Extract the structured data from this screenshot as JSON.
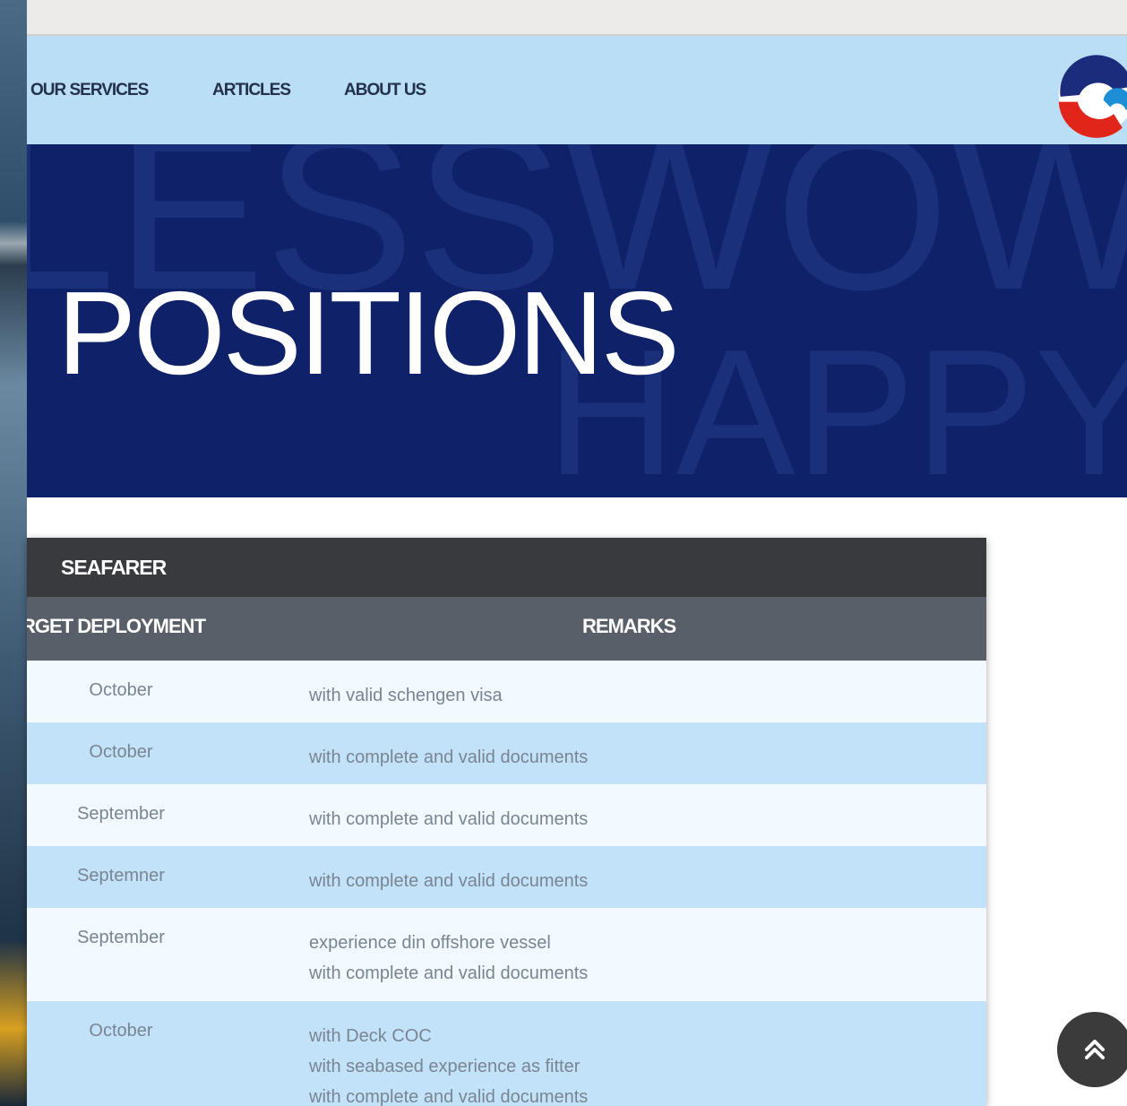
{
  "nav": {
    "links": [
      "OUR SERVICES",
      "ARTICLES",
      "ABOUT US"
    ]
  },
  "hero": {
    "title": "POSITIONS",
    "bg_words": [
      "LESSWOW",
      "HAPPYN"
    ]
  },
  "table": {
    "section_title": "SEAFARER",
    "columns": [
      "RGET DEPLOYMENT",
      "REMARKS"
    ],
    "rows": [
      {
        "deployment": "October",
        "remarks": [
          "with valid schengen visa"
        ]
      },
      {
        "deployment": "October",
        "remarks": [
          "with complete and valid documents"
        ]
      },
      {
        "deployment": "September",
        "remarks": [
          "with complete and valid documents"
        ]
      },
      {
        "deployment": "Septemner",
        "remarks": [
          "with complete and valid documents"
        ]
      },
      {
        "deployment": "September",
        "remarks": [
          "experience din offshore vessel",
          "with complete and valid documents"
        ]
      },
      {
        "deployment": "October",
        "remarks": [
          "with Deck COC",
          "with seabased experience as fitter",
          "with complete and valid documents"
        ]
      }
    ]
  },
  "colors": {
    "navbar": "#b9def6",
    "hero": "#0f2168",
    "card_header": "#383a3d",
    "table_head": "#585f68",
    "row_alt": "#c2e2f9"
  },
  "icons": {
    "logo": "company-logo",
    "scroll_top": "double-chevron-up-icon"
  }
}
